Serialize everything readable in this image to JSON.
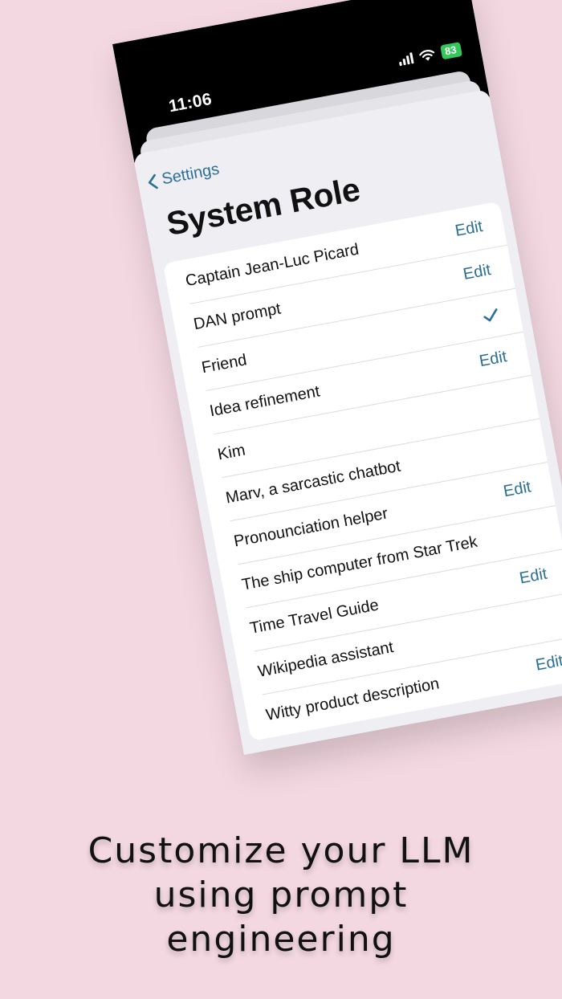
{
  "status_bar": {
    "time": "11:06",
    "battery": "83",
    "icons": [
      "cellular-signal-icon",
      "wifi-icon",
      "battery-charging-icon"
    ]
  },
  "nav": {
    "back_label": "Settings",
    "title": "System Role"
  },
  "roles": [
    {
      "name": "Captain Jean-Luc Picard",
      "accessory": "Edit"
    },
    {
      "name": "DAN prompt",
      "accessory": "Edit"
    },
    {
      "name": "Friend",
      "accessory": "",
      "selected": true
    },
    {
      "name": "Idea refinement",
      "accessory": "Edit"
    },
    {
      "name": "Kim",
      "accessory": ""
    },
    {
      "name": "Marv, a sarcastic chatbot",
      "accessory": ""
    },
    {
      "name": "Pronounciation helper",
      "accessory": "Edit"
    },
    {
      "name": "The ship computer from Star Trek",
      "accessory": ""
    },
    {
      "name": "Time Travel Guide",
      "accessory": "Edit"
    },
    {
      "name": "Wikipedia assistant",
      "accessory": ""
    },
    {
      "name": "Witty product description",
      "accessory": "Edit"
    }
  ],
  "caption": {
    "line1": "Customize your LLM",
    "line2": "using prompt",
    "line3": "engineering"
  },
  "colors": {
    "background": "#f4d8e1",
    "accent": "#2b6f97",
    "battery": "#34c759"
  }
}
